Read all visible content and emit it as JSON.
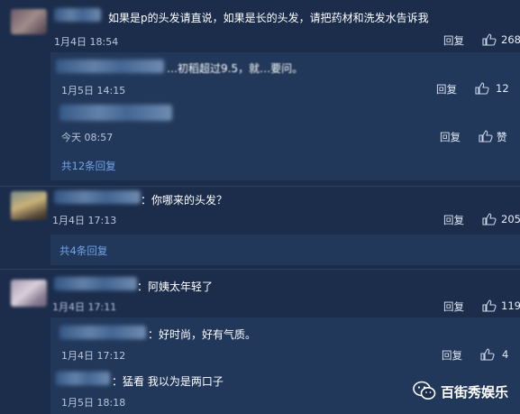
{
  "comments": [
    {
      "text": "如果是p的头发请直说，如果是长的头发，请把药材和洗发水告诉我",
      "date": "1月4日 18:54",
      "reply_label": "回复",
      "likes": "268",
      "replies": [
        {
          "text": "…初稻超过9.5，就…要问。",
          "date": "1月5日 14:15",
          "reply_label": "回复",
          "likes": "12"
        },
        {
          "text": "",
          "date": "今天 08:57",
          "reply_label": "回复",
          "likes": "赞"
        }
      ],
      "more": "共12条回复"
    },
    {
      "text": "：你哪来的头发？",
      "date": "1月4日 17:13",
      "reply_label": "回复",
      "likes": "205",
      "more": "共4条回复"
    },
    {
      "text": "：阿姨太年轻了",
      "date": "1月4日 17:11",
      "reply_label": "回复",
      "likes": "119",
      "replies": [
        {
          "text": "：好时尚，好有气质。",
          "date": "1月4日 17:12",
          "reply_label": "回复",
          "likes": "4"
        },
        {
          "text": "：猛看 我以为是两口子",
          "date": "1月5日 18:18",
          "reply_label": "",
          "likes": ""
        }
      ]
    }
  ],
  "watermark": {
    "text": "百街秀娱乐",
    "icon": "wechat-icon"
  },
  "colors": {
    "background": "#1b2d4b",
    "reply_bg": "#22385a",
    "link": "#6fa3e8"
  }
}
